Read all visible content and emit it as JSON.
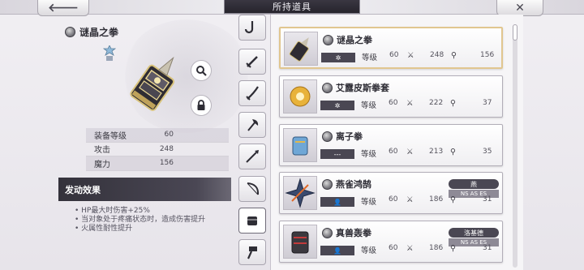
{
  "header": {
    "title": "所持道具",
    "back_icon": "🡐",
    "close_icon": "✕"
  },
  "detail": {
    "name": "谜晶之拳",
    "stats": [
      {
        "label": "装备等级",
        "value": "60"
      },
      {
        "label": "攻击",
        "value": "248"
      },
      {
        "label": "魔力",
        "value": "156"
      }
    ],
    "effect_header": "发动效果",
    "effects": [
      "• HP最大时伤害+25%",
      "• 当对象处于疼痛状态时，造成伤害提升",
      "• 火属性耐性提升"
    ]
  },
  "tabs": [
    {
      "name": "hook-icon"
    },
    {
      "name": "sword-icon"
    },
    {
      "name": "katana-icon"
    },
    {
      "name": "axe-icon"
    },
    {
      "name": "spear-icon"
    },
    {
      "name": "bow-icon"
    },
    {
      "name": "fist-icon"
    },
    {
      "name": "hammer-icon"
    }
  ],
  "list": {
    "level_label": "等级",
    "items": [
      {
        "name": "谜晶之拳",
        "slot": "✲",
        "level": "60",
        "atk": "248",
        "mag": "156"
      },
      {
        "name": "艾露皮斯拳套",
        "slot": "✲",
        "level": "60",
        "atk": "222",
        "mag": "37"
      },
      {
        "name": "离子拳",
        "slot": "---",
        "level": "60",
        "atk": "213",
        "mag": "35"
      },
      {
        "name": "燕雀鸿鹄",
        "slot": "👤",
        "level": "60",
        "atk": "186",
        "mag": "31",
        "char": "燕",
        "char_sub": "NS AS ES"
      },
      {
        "name": "真兽轰拳",
        "slot": "👤",
        "level": "60",
        "atk": "186",
        "mag": "31",
        "char": "洛基德",
        "char_sub": "NS AS ES"
      }
    ]
  },
  "colors": {
    "accent_dark": "#34323b",
    "selected_border": "#e1c68f",
    "background": "#eceaf0"
  }
}
